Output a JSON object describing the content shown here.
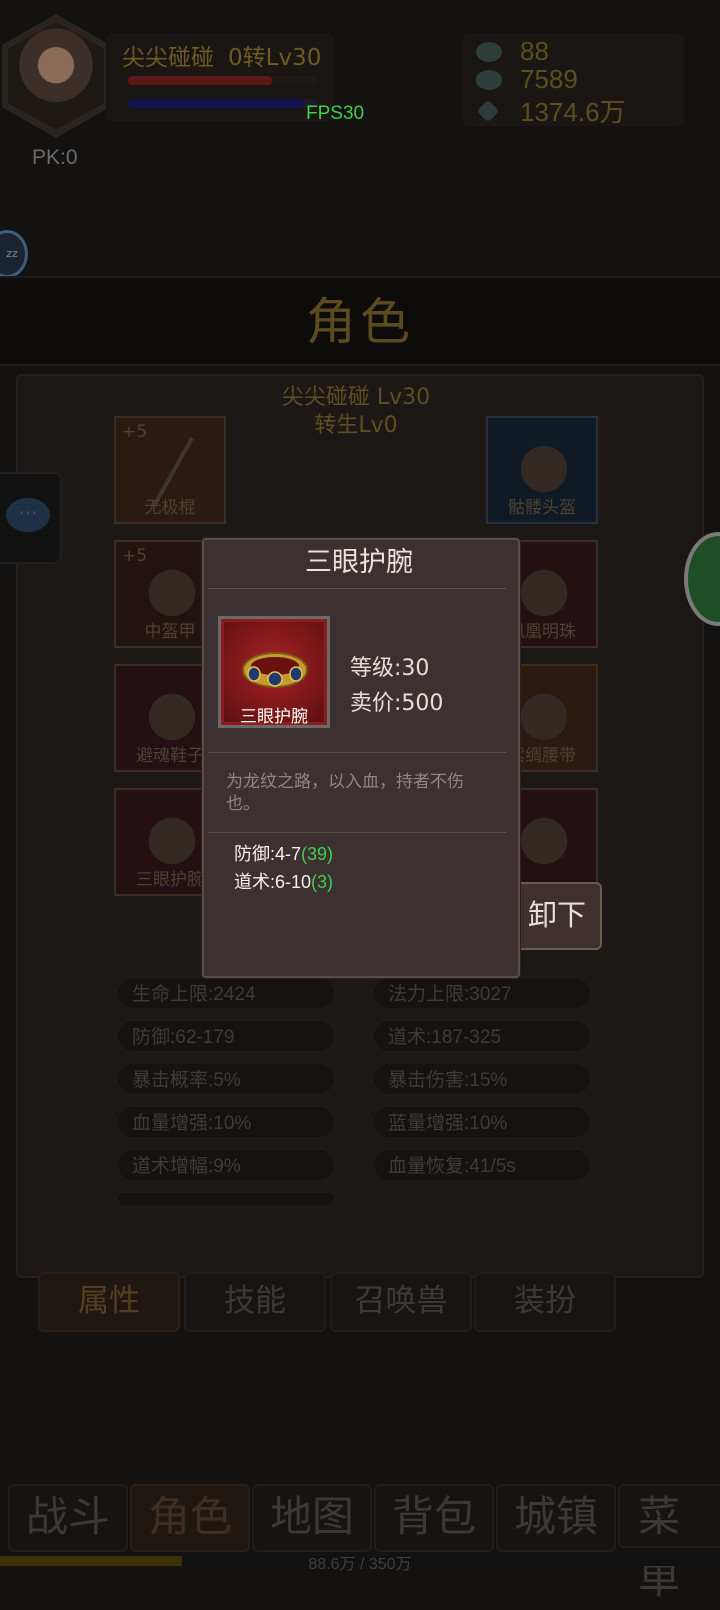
{
  "hud": {
    "player_name": "尖尖碰碰",
    "level_text": "0转Lv30",
    "fps": "FPS30",
    "pk": "PK:0",
    "hp_fraction": 0.76,
    "mp_fraction": 0.92,
    "resources": [
      {
        "icon": "ingot-icon",
        "value": "88"
      },
      {
        "icon": "ingot-icon",
        "value": "7589"
      },
      {
        "icon": "gem-icon",
        "value": "1374.6万"
      }
    ],
    "sleep_badge": "zz"
  },
  "panel": {
    "title": "角色",
    "char_name": "尖尖碰碰 Lv30",
    "rebirth": "转生Lv0",
    "left_slots": [
      {
        "plus": "+5",
        "label": "无极棍"
      },
      {
        "plus": "+5",
        "label": "中盔甲"
      },
      {
        "plus": "",
        "label": "避魂鞋子"
      },
      {
        "plus": "",
        "label": "三眼护腕"
      }
    ],
    "right_slots": [
      {
        "label": "骷髅头盔"
      },
      {
        "label": "凤凰明珠"
      },
      {
        "label": "紫绸腰带"
      },
      {
        "label": ""
      }
    ],
    "unequip_label": "卸下",
    "stats": [
      {
        "left": "生命上限:2424",
        "right": "法力上限:3027"
      },
      {
        "left": "防御:62-179",
        "right": "道术:187-325"
      },
      {
        "left": "暴击概率:5%",
        "right": "暴击伤害:15%"
      },
      {
        "left": "血量增强:10%",
        "right": "蓝量增强:10%"
      },
      {
        "left": "道术增幅:9%",
        "right": "血量恢复:41/5s"
      }
    ],
    "tabs": [
      "属性",
      "技能",
      "召唤兽",
      "装扮"
    ]
  },
  "popup": {
    "title": "三眼护腕",
    "item_label": "三眼护腕",
    "level": "等级:30",
    "price": "卖价:500",
    "description": "为龙纹之路，以入血，持者不伤也。",
    "stats": [
      {
        "text": "防御:4-7",
        "bonus": "(39)"
      },
      {
        "text": "道术:6-10",
        "bonus": "(3)"
      }
    ]
  },
  "nav": {
    "items": [
      "战斗",
      "角色",
      "地图",
      "背包",
      "城镇",
      "菜单"
    ],
    "active": "角色",
    "xp_text": "88.6万 / 350万",
    "xp_fraction": 0.253
  },
  "colors": {
    "accent_gold": "#5b4b1e",
    "fps_green": "#3fcf4f",
    "item_red": "#8e1d1f"
  }
}
